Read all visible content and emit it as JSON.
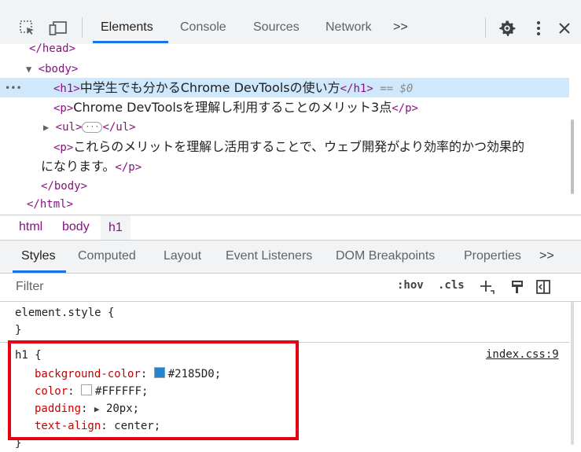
{
  "toolbar": {
    "tabs": [
      {
        "label": "Elements"
      },
      {
        "label": "Console"
      },
      {
        "label": "Sources"
      },
      {
        "label": "Network"
      }
    ],
    "more_tabs": ">>"
  },
  "tree": {
    "lines": [
      {
        "text": "</head>"
      },
      {
        "text": "<body>"
      },
      {
        "ellipsis": "•••",
        "open": "<h1>",
        "content": "中学生でも分かるChrome DevToolsの使い方",
        "close": "</h1>",
        "eq": " == $0"
      },
      {
        "open": "<p>",
        "content": "Chrome DevToolsを理解し利用することのメリット3点",
        "close": "</p>"
      },
      {
        "open": "<ul>",
        "badge": "···",
        "close": "</ul>"
      },
      {
        "open": "<p>",
        "content": "これらのメリットを理解し活用することで、ウェブ開発がより効率的かつ効果的"
      },
      {
        "content": "になります。",
        "close": "</p>"
      },
      {
        "text": "</body>"
      },
      {
        "text": "</html>"
      }
    ]
  },
  "breadcrumb": [
    "html",
    "body",
    "h1"
  ],
  "styles_tabs": [
    {
      "label": "Styles"
    },
    {
      "label": "Computed"
    },
    {
      "label": "Layout"
    },
    {
      "label": "Event Listeners"
    },
    {
      "label": "DOM Breakpoints"
    },
    {
      "label": "Properties"
    }
  ],
  "styles_more": ">>",
  "filter": {
    "placeholder": "Filter",
    "hov": ":hov",
    "cls": ".cls"
  },
  "rules": {
    "element_style": {
      "selector": "element.style {",
      "close": "}"
    },
    "h1": {
      "selector": "h1 {",
      "source": "index.css:9",
      "declarations": [
        {
          "prop": "background-color",
          "value": "#2185D0",
          "swatch": "#2185D0"
        },
        {
          "prop": "color",
          "value": "#FFFFFF",
          "swatch": "#FFFFFF"
        },
        {
          "prop": "padding",
          "value": "20px",
          "expand": "▶"
        },
        {
          "prop": "text-align",
          "value": "center"
        }
      ],
      "close": "}"
    }
  },
  "colors": {
    "accent": "#1a73e8",
    "tag": "#881280",
    "property": "#c80000",
    "highlight_box": "#e60012",
    "selected_row": "#cfe8fc"
  }
}
